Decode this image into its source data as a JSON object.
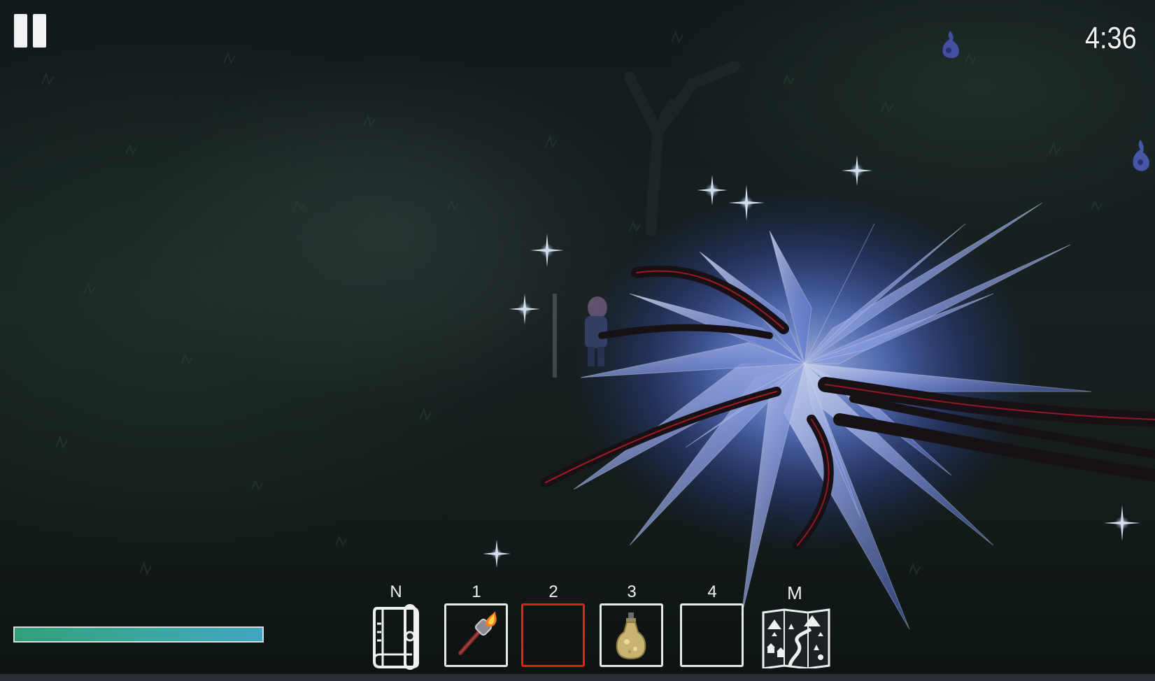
{
  "hud": {
    "timer": "4:36",
    "health_fraction": 1.0,
    "colors": {
      "health_start": "#2fa07a",
      "health_end": "#3ea6c2",
      "selected_slot": "#ee1c1c",
      "slot_border": "#e8e8e8"
    }
  },
  "hotbar": {
    "selected_index": 2,
    "slots": [
      {
        "key": "N",
        "item": "journal-icon"
      },
      {
        "key": "1",
        "item": "torch-icon"
      },
      {
        "key": "2",
        "item": ""
      },
      {
        "key": "3",
        "item": "lantern-bottle-icon"
      },
      {
        "key": "4",
        "item": ""
      },
      {
        "key": "M",
        "item": "map-icon"
      }
    ]
  },
  "status_icons": [
    "spirit-flame-icon",
    "spirit-flame-icon"
  ]
}
